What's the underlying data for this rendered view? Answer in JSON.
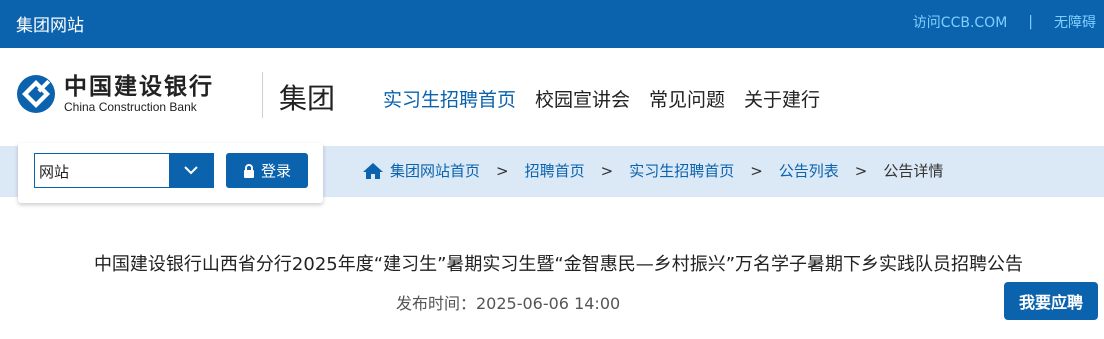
{
  "topbar": {
    "group_site": "集团网站",
    "visit_ccb": "访问CCB.COM",
    "separator": "|",
    "accessibility": "无障碍"
  },
  "header": {
    "logo_cn": "中国建设银行",
    "logo_en": "China Construction Bank",
    "group_title": "集团",
    "nav": [
      {
        "label": "实习生招聘首页",
        "active": true
      },
      {
        "label": "校园宣讲会",
        "active": false
      },
      {
        "label": "常见问题",
        "active": false
      },
      {
        "label": "关于建行",
        "active": false
      }
    ]
  },
  "search": {
    "site_value": "网站",
    "login_label": "登录"
  },
  "breadcrumb": {
    "items": [
      "集团网站首页",
      "招聘首页",
      "实习生招聘首页",
      "公告列表"
    ],
    "current": "公告详情",
    "arrow": ">"
  },
  "article": {
    "title": "中国建设银行山西省分行2025年度“建习生”暑期实习生暨“金智惠民—乡村振兴”万名学子暑期下乡实践队员招聘公告",
    "publish_time": "发布时间：2025-06-06 14:00",
    "apply_label": "我要应聘"
  },
  "colors": {
    "brand": "#0b63ad",
    "topbar_link": "#7fd0ff",
    "crumb_strip": "#dbe8f6"
  }
}
